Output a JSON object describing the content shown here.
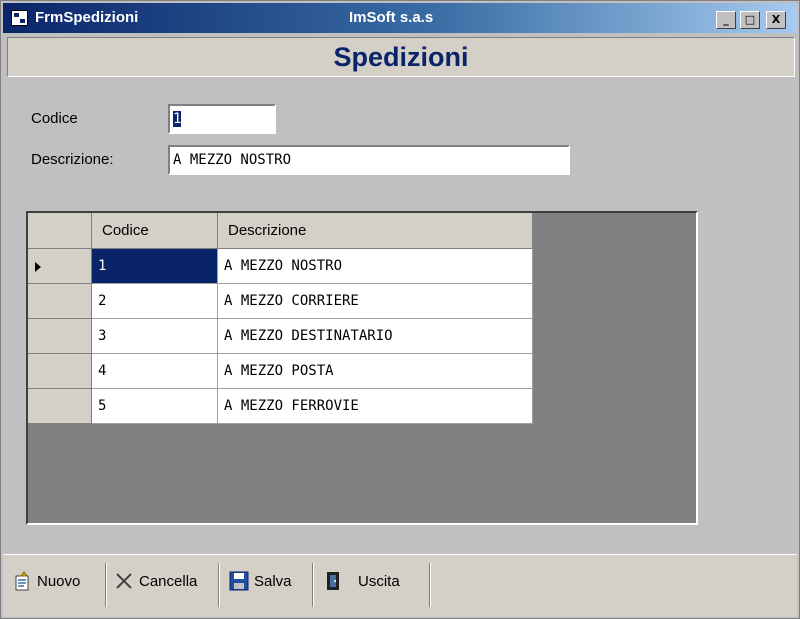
{
  "window": {
    "title": "FrmSpedizioni",
    "company": "ImSoft s.a.s",
    "minimize_label": "_",
    "maximize_label": "□",
    "close_label": "X"
  },
  "heading": "Spedizioni",
  "form": {
    "codice_label": "Codice",
    "codice_value": "1",
    "descrizione_label": "Descrizione:",
    "descrizione_value": "A MEZZO NOSTRO"
  },
  "grid": {
    "columns": [
      "Codice",
      "Descrizione"
    ],
    "rows": [
      {
        "codice": "1",
        "descrizione": "A MEZZO NOSTRO",
        "selected": true
      },
      {
        "codice": "2",
        "descrizione": "A MEZZO CORRIERE"
      },
      {
        "codice": "3",
        "descrizione": "A MEZZO DESTINATARIO"
      },
      {
        "codice": "4",
        "descrizione": "A MEZZO POSTA"
      },
      {
        "codice": "5",
        "descrizione": "A MEZZO FERROVIE"
      }
    ]
  },
  "toolbar": {
    "nuovo_label": "Nuovo",
    "cancella_label": "Cancella",
    "salva_label": "Salva",
    "uscita_label": "Uscita"
  },
  "icons": {
    "app": "app-window-icon",
    "nuovo": "new-document-icon",
    "cancella": "x-delete-icon",
    "salva": "floppy-disk-icon",
    "uscita": "exit-door-icon"
  },
  "colors": {
    "titlebar_start": "#0a246a",
    "titlebar_end": "#a6caf0",
    "heading_text": "#0a246a",
    "selection": "#0a246a",
    "grid_background": "#808080"
  }
}
